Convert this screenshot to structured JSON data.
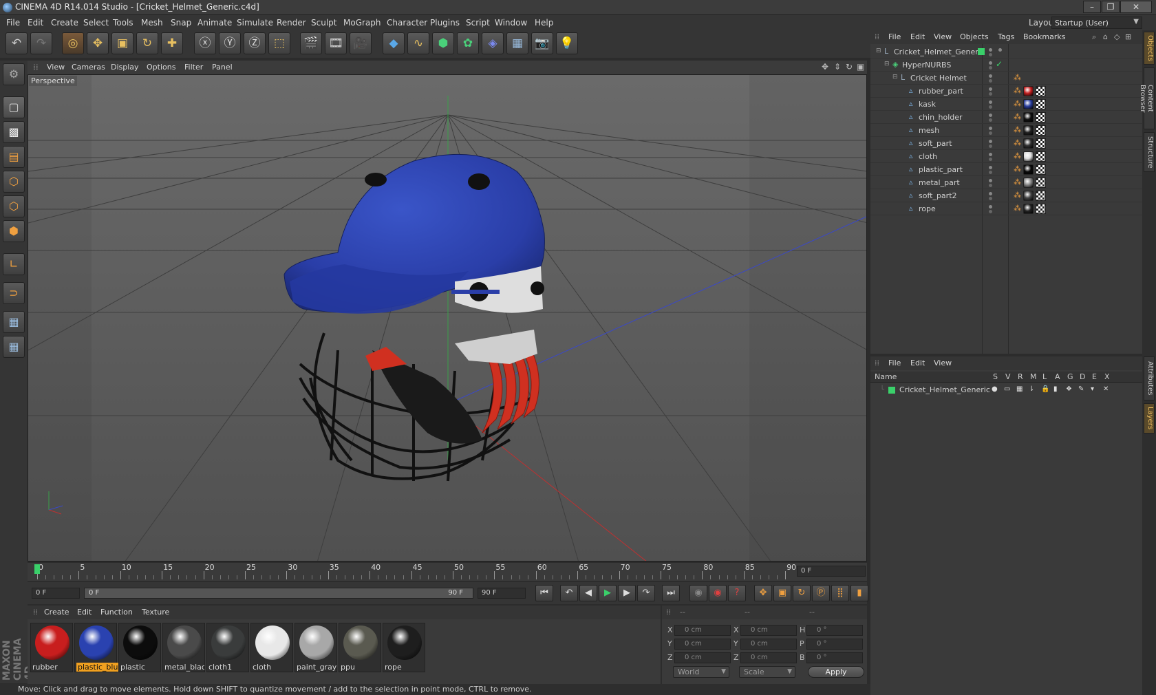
{
  "window": {
    "title": "CINEMA 4D R14.014 Studio - [Cricket_Helmet_Generic.c4d]",
    "layout_label": "Layout:",
    "layout_value": "Startup (User)"
  },
  "menu": [
    "File",
    "Edit",
    "Create",
    "Select",
    "Tools",
    "Mesh",
    "Snap",
    "Animate",
    "Simulate",
    "Render",
    "Sculpt",
    "MoGraph",
    "Character",
    "Plugins",
    "Script",
    "Window",
    "Help"
  ],
  "viewport": {
    "menu": [
      "View",
      "Cameras",
      "Display",
      "Options",
      "Filter",
      "Panel"
    ],
    "label": "Perspective"
  },
  "objects_panel": {
    "menu": [
      "File",
      "Edit",
      "View",
      "Objects",
      "Tags",
      "Bookmarks"
    ],
    "items": [
      {
        "name": "Cricket_Helmet_Generic",
        "depth": 0,
        "tag": "",
        "type": "null"
      },
      {
        "name": "HyperNURBS",
        "depth": 1,
        "tag": "",
        "type": "nurbs"
      },
      {
        "name": "Cricket Helmet",
        "depth": 2,
        "tag": "",
        "type": "null"
      },
      {
        "name": "rubber_part",
        "depth": 3,
        "tag": "#c22020",
        "type": "poly"
      },
      {
        "name": "kask",
        "depth": 3,
        "tag": "#2b3f9e",
        "type": "poly"
      },
      {
        "name": "chin_holder",
        "depth": 3,
        "tag": "#111111",
        "type": "poly"
      },
      {
        "name": "mesh",
        "depth": 3,
        "tag": "#222222",
        "type": "poly"
      },
      {
        "name": "soft_part",
        "depth": 3,
        "tag": "#333333",
        "type": "poly"
      },
      {
        "name": "cloth",
        "depth": 3,
        "tag": "#dddddd",
        "type": "poly"
      },
      {
        "name": "plastic_part",
        "depth": 3,
        "tag": "#0a0a0a",
        "type": "poly"
      },
      {
        "name": "metal_part",
        "depth": 3,
        "tag": "#888888",
        "type": "poly"
      },
      {
        "name": "soft_part2",
        "depth": 3,
        "tag": "#444444",
        "type": "poly"
      },
      {
        "name": "rope",
        "depth": 3,
        "tag": "#222222",
        "type": "poly"
      }
    ]
  },
  "layers_panel": {
    "menu": [
      "File",
      "Edit",
      "View"
    ],
    "header_name": "Name",
    "columns": [
      "S",
      "V",
      "R",
      "M",
      "L",
      "A",
      "G",
      "D",
      "E",
      "X"
    ],
    "layer_name": "Cricket_Helmet_Generic"
  },
  "timeline": {
    "ticks": [
      "0",
      "5",
      "10",
      "15",
      "20",
      "25",
      "30",
      "35",
      "40",
      "45",
      "50",
      "55",
      "60",
      "65",
      "70",
      "75",
      "80",
      "85",
      "90"
    ],
    "current_frame": "0 F",
    "start_field": "0 F",
    "range_start": "0 F",
    "range_end": "90 F",
    "end_field": "90 F"
  },
  "materials": {
    "menu": [
      "Create",
      "Edit",
      "Function",
      "Texture"
    ],
    "items": [
      {
        "name": "rubber",
        "color": "#c81e1e"
      },
      {
        "name": "plastic_blu",
        "color": "#2a42b0",
        "selected": true
      },
      {
        "name": "plastic",
        "color": "#0c0c0c"
      },
      {
        "name": "metal_blac",
        "color": "#4a4a4a"
      },
      {
        "name": "cloth1",
        "color": "#3a3c3c"
      },
      {
        "name": "cloth",
        "color": "#e8e8e8"
      },
      {
        "name": "paint_gray",
        "color": "#a8a8a8"
      },
      {
        "name": "ppu",
        "color": "#5a5a50"
      },
      {
        "name": "rope",
        "color": "#1e1e1e"
      }
    ]
  },
  "coords": {
    "headers": [
      "--",
      "--",
      "--"
    ],
    "rows": [
      {
        "l1": "X",
        "v1": "0 cm",
        "l2": "X",
        "v2": "0 cm",
        "l3": "H",
        "v3": "0 °"
      },
      {
        "l1": "Y",
        "v1": "0 cm",
        "l2": "Y",
        "v2": "0 cm",
        "l3": "P",
        "v3": "0 °"
      },
      {
        "l1": "Z",
        "v1": "0 cm",
        "l2": "Z",
        "v2": "0 cm",
        "l3": "B",
        "v3": "0 °"
      }
    ],
    "space": "World",
    "mode": "Scale",
    "apply": "Apply"
  },
  "side_tabs": [
    "Objects",
    "Content Browser",
    "Structure",
    "Attributes",
    "Layers"
  ],
  "status": "Move: Click and drag to move elements. Hold down SHIFT to quantize movement / add to the selection in point mode, CTRL to remove.",
  "brand": "MAXON CINEMA 4D"
}
